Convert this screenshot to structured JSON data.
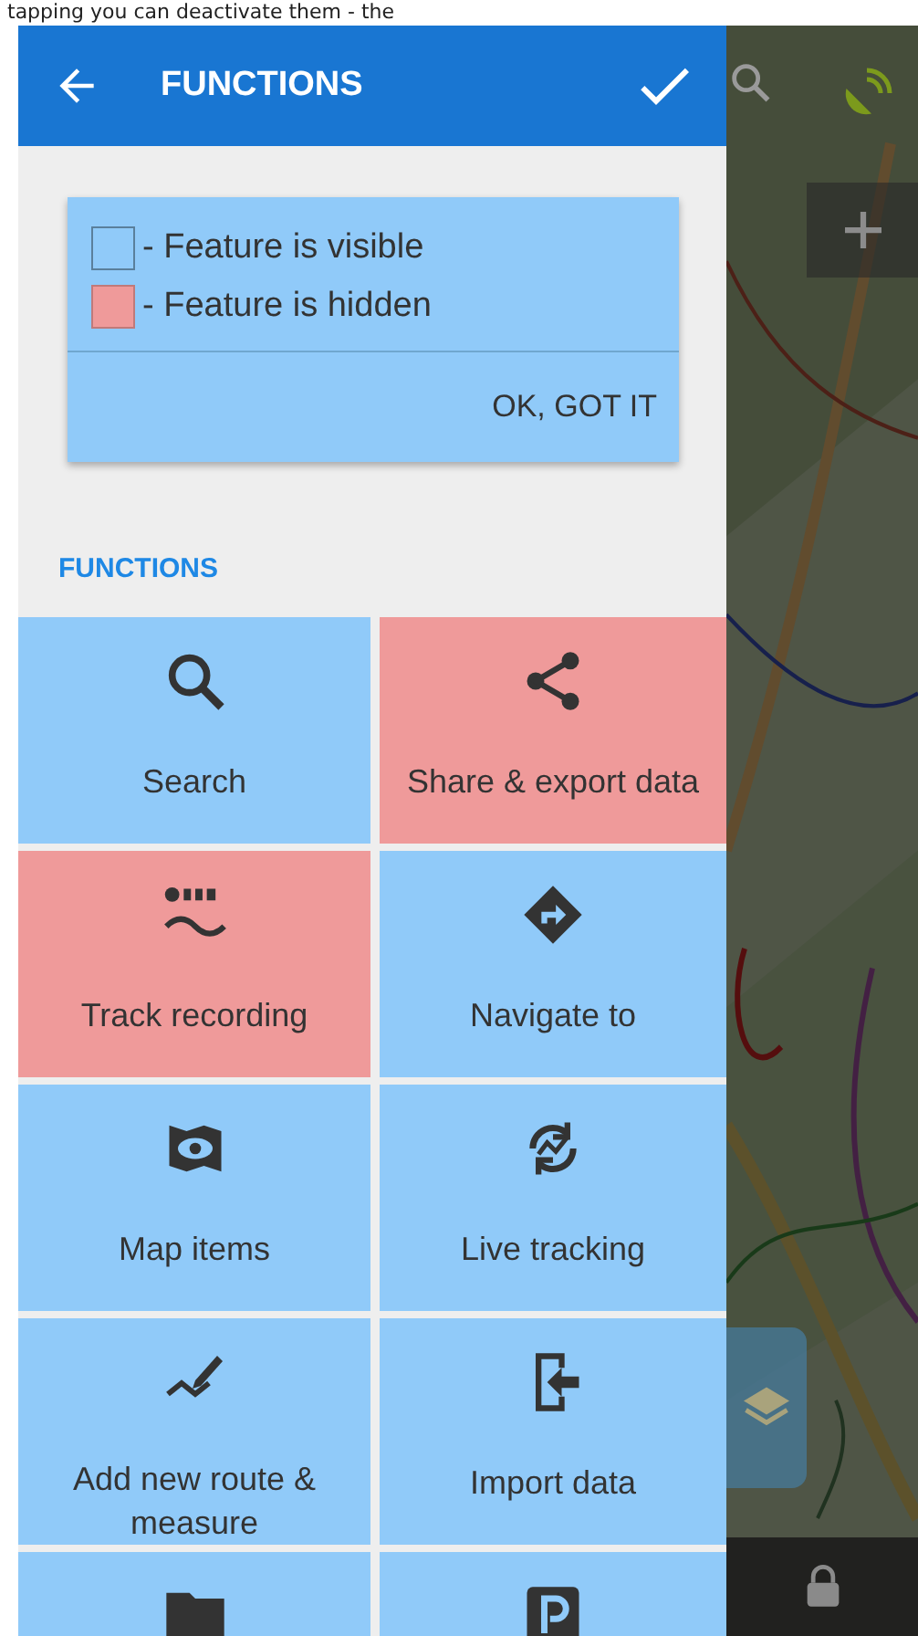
{
  "caption": "tapping you can deactivate them - the",
  "header": {
    "title": "FUNCTIONS"
  },
  "legend": {
    "items": [
      {
        "label": "- Feature is visible",
        "hidden": false
      },
      {
        "label": "- Feature is hidden",
        "hidden": true
      }
    ],
    "button": "OK, GOT IT"
  },
  "section": {
    "title": "FUNCTIONS"
  },
  "tiles": [
    {
      "label": "Search",
      "hidden": false
    },
    {
      "label": "Share & export data",
      "hidden": true
    },
    {
      "label": "Track recording",
      "hidden": true
    },
    {
      "label": "Navigate to",
      "hidden": false
    },
    {
      "label": "Map items",
      "hidden": false
    },
    {
      "label": "Live tracking",
      "hidden": false
    },
    {
      "label": "Add new route & measure",
      "hidden": false
    },
    {
      "label": "Import data",
      "hidden": false
    },
    {
      "hidden": false
    },
    {
      "hidden": false
    }
  ]
}
